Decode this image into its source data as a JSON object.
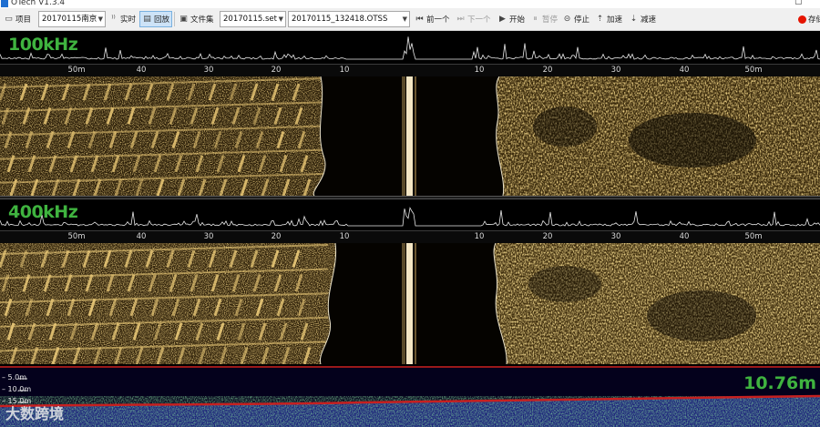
{
  "window": {
    "title": "OTech V1.3.4",
    "restore_glyph": "▢"
  },
  "toolbar": {
    "project_label": "项目",
    "project_value": "20170115南京",
    "realtime_label": "实时",
    "playback_label": "回放",
    "file_set_label": "文件集",
    "set_value": "20170115.set",
    "file_value": "20170115_132418.OTSS",
    "prev_label": "前一个",
    "next_label": "下一个",
    "start_label": "开始",
    "pause_label": "暂停",
    "stop_label": "停止",
    "speed_up_label": "加速",
    "slow_down_label": "减速",
    "record_label": "存储",
    "accent_color": "#1f6fd1",
    "record_color": "#e51400"
  },
  "channels": [
    {
      "frequency": "100kHz"
    },
    {
      "frequency": "400kHz"
    }
  ],
  "range_scale": {
    "left_labels": [
      "50m",
      "40",
      "30",
      "20",
      "10"
    ],
    "right_labels": [
      "10",
      "20",
      "30",
      "40",
      "50m"
    ]
  },
  "depth": {
    "labels": [
      "5.0m",
      "10.0m",
      "15.0m"
    ],
    "reading": "10.76m",
    "reading_color": "#3fb33f"
  },
  "watermark": "大数跨境",
  "colors": {
    "sonar_gold": "#d8a23a",
    "frequency_text": "#3fb33f",
    "depth_band_red": "#c62020"
  }
}
